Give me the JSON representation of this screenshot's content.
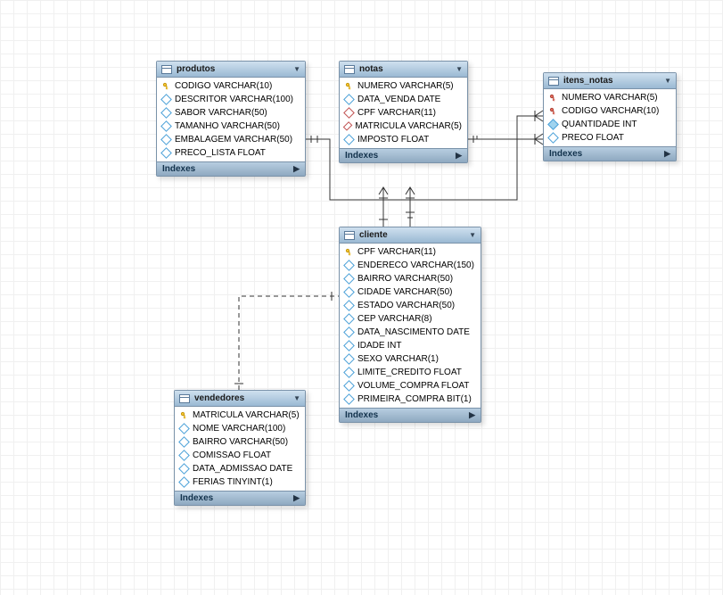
{
  "entities": {
    "produtos": {
      "title": "produtos",
      "cols": [
        {
          "icon": "key",
          "text": "CODIGO VARCHAR(10)"
        },
        {
          "icon": "diamond",
          "text": "DESCRITOR VARCHAR(100)"
        },
        {
          "icon": "diamond",
          "text": "SABOR VARCHAR(50)"
        },
        {
          "icon": "diamond",
          "text": "TAMANHO VARCHAR(50)"
        },
        {
          "icon": "diamond",
          "text": "EMBALAGEM VARCHAR(50)"
        },
        {
          "icon": "diamond",
          "text": "PRECO_LISTA FLOAT"
        }
      ],
      "footer": "Indexes"
    },
    "notas": {
      "title": "notas",
      "cols": [
        {
          "icon": "key",
          "text": "NUMERO VARCHAR(5)"
        },
        {
          "icon": "diamond",
          "text": "DATA_VENDA DATE"
        },
        {
          "icon": "reddiamond",
          "text": "CPF VARCHAR(11)"
        },
        {
          "icon": "reddiamond",
          "text": "MATRICULA VARCHAR(5)"
        },
        {
          "icon": "diamond",
          "text": "IMPOSTO FLOAT"
        }
      ],
      "footer": "Indexes"
    },
    "itens_notas": {
      "title": "itens_notas",
      "cols": [
        {
          "icon": "fkey",
          "text": "NUMERO VARCHAR(5)"
        },
        {
          "icon": "fkey",
          "text": "CODIGO VARCHAR(10)"
        },
        {
          "icon": "filleddiamond",
          "text": "QUANTIDADE INT"
        },
        {
          "icon": "diamond",
          "text": "PRECO FLOAT"
        }
      ],
      "footer": "Indexes"
    },
    "cliente": {
      "title": "cliente",
      "cols": [
        {
          "icon": "key",
          "text": "CPF VARCHAR(11)"
        },
        {
          "icon": "diamond",
          "text": "ENDERECO VARCHAR(150)"
        },
        {
          "icon": "diamond",
          "text": "BAIRRO VARCHAR(50)"
        },
        {
          "icon": "diamond",
          "text": "CIDADE VARCHAR(50)"
        },
        {
          "icon": "diamond",
          "text": "ESTADO VARCHAR(50)"
        },
        {
          "icon": "diamond",
          "text": "CEP VARCHAR(8)"
        },
        {
          "icon": "diamond",
          "text": "DATA_NASCIMENTO DATE"
        },
        {
          "icon": "diamond",
          "text": "IDADE INT"
        },
        {
          "icon": "diamond",
          "text": "SEXO VARCHAR(1)"
        },
        {
          "icon": "diamond",
          "text": "LIMITE_CREDITO FLOAT"
        },
        {
          "icon": "diamond",
          "text": "VOLUME_COMPRA FLOAT"
        },
        {
          "icon": "diamond",
          "text": "PRIMEIRA_COMPRA BIT(1)"
        }
      ],
      "footer": "Indexes"
    },
    "vendedores": {
      "title": "vendedores",
      "cols": [
        {
          "icon": "key",
          "text": "MATRICULA VARCHAR(5)"
        },
        {
          "icon": "diamond",
          "text": "NOME VARCHAR(100)"
        },
        {
          "icon": "diamond",
          "text": "BAIRRO VARCHAR(50)"
        },
        {
          "icon": "diamond",
          "text": "COMISSAO FLOAT"
        },
        {
          "icon": "diamond",
          "text": "DATA_ADMISSAO DATE"
        },
        {
          "icon": "diamond",
          "text": "FERIAS TINYINT(1)"
        }
      ],
      "footer": "Indexes"
    }
  },
  "relationships": [
    {
      "from": "produtos",
      "to": "itens_notas",
      "via": "CODIGO",
      "type": "identifying",
      "card": "1:N"
    },
    {
      "from": "notas",
      "to": "itens_notas",
      "via": "NUMERO",
      "type": "identifying",
      "card": "1:N"
    },
    {
      "from": "cliente",
      "to": "notas",
      "via": "CPF",
      "type": "non-identifying",
      "card": "1:N"
    },
    {
      "from": "vendedores",
      "to": "notas",
      "via": "MATRICULA",
      "type": "non-identifying",
      "card": "1:N"
    },
    {
      "from": "vendedores",
      "to": "cliente",
      "via": null,
      "type": "non-identifying",
      "card": "1:1",
      "style": "dashed"
    }
  ]
}
